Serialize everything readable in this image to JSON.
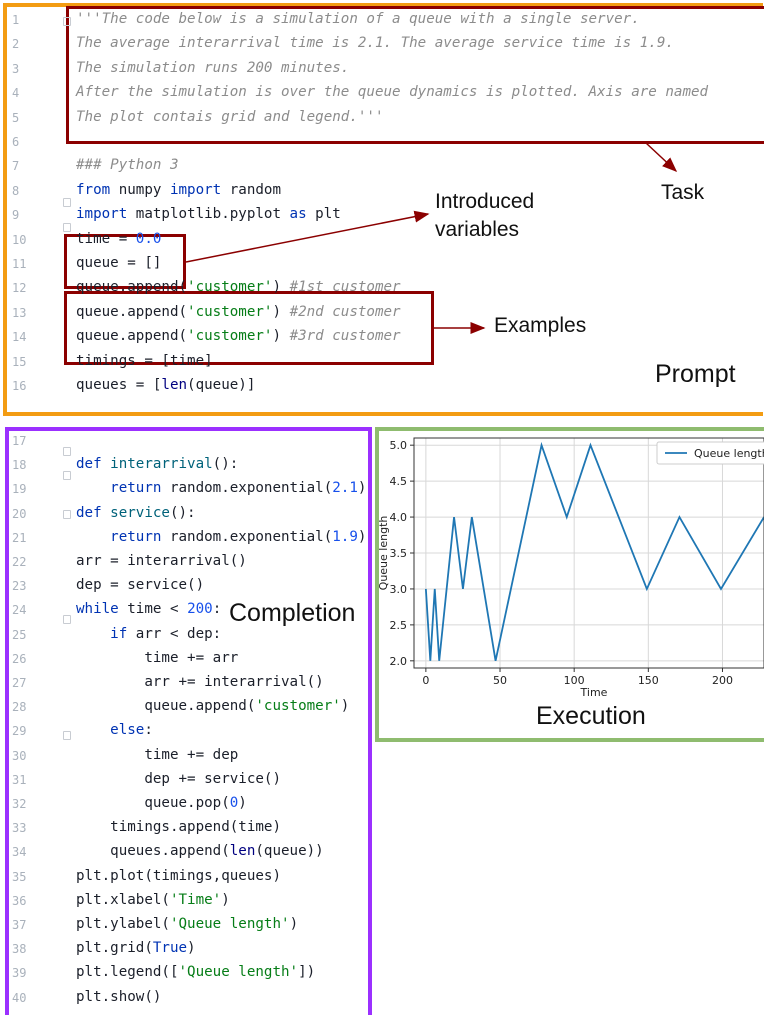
{
  "prompt": {
    "lines": [
      {
        "n": "1",
        "segs": [
          [
            "doc",
            "'''The code below is a simulation of a queue with a single server."
          ]
        ]
      },
      {
        "n": "2",
        "segs": [
          [
            "doc",
            "The average interarrival time is 2.1. The average service time is 1.9."
          ]
        ]
      },
      {
        "n": "3",
        "segs": [
          [
            "doc",
            "The simulation runs 200 minutes."
          ]
        ]
      },
      {
        "n": "4",
        "segs": [
          [
            "doc",
            "After the simulation is over the queue dynamics is plotted. Axis are named"
          ]
        ]
      },
      {
        "n": "5",
        "segs": [
          [
            "doc",
            "The plot contais grid and legend.'''"
          ]
        ]
      },
      {
        "n": "6",
        "segs": []
      },
      {
        "n": "7",
        "segs": [
          [
            "cm",
            "### Python 3"
          ]
        ]
      },
      {
        "n": "8",
        "segs": [
          [
            "kw",
            "from"
          ],
          [
            "plain",
            " numpy "
          ],
          [
            "kw",
            "import"
          ],
          [
            "plain",
            " random"
          ]
        ]
      },
      {
        "n": "9",
        "segs": [
          [
            "kw",
            "import"
          ],
          [
            "plain",
            " matplotlib.pyplot "
          ],
          [
            "kw",
            "as"
          ],
          [
            "plain",
            " plt"
          ]
        ]
      },
      {
        "n": "10",
        "segs": [
          [
            "plain",
            "time = "
          ],
          [
            "num",
            "0.0"
          ]
        ]
      },
      {
        "n": "11",
        "segs": [
          [
            "plain",
            "queue = []"
          ]
        ]
      },
      {
        "n": "12",
        "segs": [
          [
            "plain",
            "queue.append("
          ],
          [
            "str",
            "'customer'"
          ],
          [
            "plain",
            ") "
          ],
          [
            "cm",
            "#1st customer"
          ]
        ]
      },
      {
        "n": "13",
        "segs": [
          [
            "plain",
            "queue.append("
          ],
          [
            "str",
            "'customer'"
          ],
          [
            "plain",
            ") "
          ],
          [
            "cm",
            "#2nd customer"
          ]
        ]
      },
      {
        "n": "14",
        "segs": [
          [
            "plain",
            "queue.append("
          ],
          [
            "str",
            "'customer'"
          ],
          [
            "plain",
            ") "
          ],
          [
            "cm",
            "#3rd customer"
          ]
        ]
      },
      {
        "n": "15",
        "segs": [
          [
            "plain",
            "timings = [time]"
          ]
        ]
      },
      {
        "n": "16",
        "segs": [
          [
            "plain",
            "queues = ["
          ],
          [
            "bi",
            "len"
          ],
          [
            "plain",
            "(queue)]"
          ]
        ]
      }
    ]
  },
  "completion": {
    "lines": [
      {
        "n": "17",
        "segs": []
      },
      {
        "n": "18",
        "segs": [
          [
            "kw",
            "def"
          ],
          [
            "plain",
            " "
          ],
          [
            "fn",
            "interarrival"
          ],
          [
            "plain",
            "():"
          ]
        ]
      },
      {
        "n": "19",
        "segs": [
          [
            "plain",
            "    "
          ],
          [
            "kw",
            "return"
          ],
          [
            "plain",
            " random.exponential("
          ],
          [
            "num",
            "2.1"
          ],
          [
            "plain",
            ")"
          ]
        ]
      },
      {
        "n": "20",
        "segs": [
          [
            "kw",
            "def"
          ],
          [
            "plain",
            " "
          ],
          [
            "fn",
            "service"
          ],
          [
            "plain",
            "():"
          ]
        ]
      },
      {
        "n": "21",
        "segs": [
          [
            "plain",
            "    "
          ],
          [
            "kw",
            "return"
          ],
          [
            "plain",
            " random.exponential("
          ],
          [
            "num",
            "1.9"
          ],
          [
            "plain",
            ")"
          ]
        ]
      },
      {
        "n": "22",
        "segs": [
          [
            "plain",
            "arr = interarrival()"
          ]
        ]
      },
      {
        "n": "23",
        "segs": [
          [
            "plain",
            "dep = service()"
          ]
        ]
      },
      {
        "n": "24",
        "segs": [
          [
            "kw",
            "while"
          ],
          [
            "plain",
            " time < "
          ],
          [
            "num",
            "200"
          ],
          [
            "plain",
            ":"
          ]
        ]
      },
      {
        "n": "25",
        "segs": [
          [
            "plain",
            "    "
          ],
          [
            "kw",
            "if"
          ],
          [
            "plain",
            " arr < dep:"
          ]
        ]
      },
      {
        "n": "26",
        "segs": [
          [
            "plain",
            "        time += arr"
          ]
        ]
      },
      {
        "n": "27",
        "segs": [
          [
            "plain",
            "        arr += interarrival()"
          ]
        ]
      },
      {
        "n": "28",
        "segs": [
          [
            "plain",
            "        queue.append("
          ],
          [
            "str",
            "'customer'"
          ],
          [
            "plain",
            ")"
          ]
        ]
      },
      {
        "n": "29",
        "segs": [
          [
            "plain",
            "    "
          ],
          [
            "kw",
            "else"
          ],
          [
            "plain",
            ":"
          ]
        ]
      },
      {
        "n": "30",
        "segs": [
          [
            "plain",
            "        time += dep"
          ]
        ]
      },
      {
        "n": "31",
        "segs": [
          [
            "plain",
            "        dep += service()"
          ]
        ]
      },
      {
        "n": "32",
        "segs": [
          [
            "plain",
            "        queue.pop("
          ],
          [
            "num",
            "0"
          ],
          [
            "plain",
            ")"
          ]
        ]
      },
      {
        "n": "33",
        "segs": [
          [
            "plain",
            "    timings.append(time)"
          ]
        ]
      },
      {
        "n": "34",
        "segs": [
          [
            "plain",
            "    queues.append("
          ],
          [
            "bi",
            "len"
          ],
          [
            "plain",
            "(queue))"
          ]
        ]
      },
      {
        "n": "35",
        "segs": [
          [
            "plain",
            "plt.plot(timings,queues)"
          ]
        ]
      },
      {
        "n": "36",
        "segs": [
          [
            "plain",
            "plt.xlabel("
          ],
          [
            "str",
            "'Time'"
          ],
          [
            "plain",
            ")"
          ]
        ]
      },
      {
        "n": "37",
        "segs": [
          [
            "plain",
            "plt.ylabel("
          ],
          [
            "str",
            "'Queue length'"
          ],
          [
            "plain",
            ")"
          ]
        ]
      },
      {
        "n": "38",
        "segs": [
          [
            "plain",
            "plt.grid("
          ],
          [
            "kw",
            "True"
          ],
          [
            "plain",
            ")"
          ]
        ]
      },
      {
        "n": "39",
        "segs": [
          [
            "plain",
            "plt.legend(["
          ],
          [
            "str",
            "'Queue length'"
          ],
          [
            "plain",
            "])"
          ]
        ]
      },
      {
        "n": "40",
        "segs": [
          [
            "plain",
            "plt.show()"
          ]
        ]
      }
    ]
  },
  "labels": {
    "task": "Task",
    "introduced": "Introduced",
    "variables": "variables",
    "examples": "Examples",
    "prompt": "Prompt",
    "completion": "Completion",
    "execution": "Execution"
  },
  "colors": {
    "prompt_border": "#f39c12",
    "completion_border": "#8a2be2",
    "execution_border": "#8fbc6f",
    "highlight": "#8b0000",
    "line_color": "#1f77b4"
  },
  "chart_data": {
    "type": "line",
    "xlabel": "Time",
    "ylabel": "Queue length",
    "legend": [
      "Queue length"
    ],
    "legend_position": "top-right",
    "grid": true,
    "xticks": [
      0,
      50,
      100,
      150,
      200
    ],
    "yticks": [
      2.0,
      2.5,
      3.0,
      3.5,
      4.0,
      4.5,
      5.0
    ],
    "xlim": [
      -8,
      228
    ],
    "ylim": [
      1.9,
      5.1
    ],
    "series": [
      {
        "name": "Queue length",
        "x": [
          0,
          3,
          6,
          9,
          19,
          25,
          31,
          47,
          78,
          95,
          111,
          149,
          171,
          199,
          228
        ],
        "y": [
          3,
          2,
          3,
          2,
          4,
          3,
          4,
          2,
          5,
          4,
          5,
          3,
          4,
          3,
          4
        ]
      }
    ]
  }
}
